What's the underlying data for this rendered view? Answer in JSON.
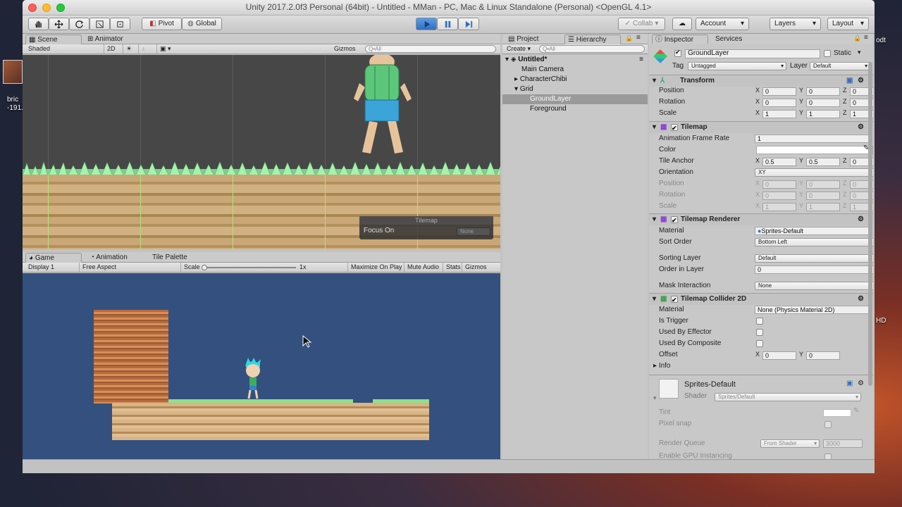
{
  "desktop": {
    "right_label": "odt",
    "left_label_1": "bric",
    "left_label_2": "-191...",
    "side_label": "HD"
  },
  "window": {
    "title": "Unity 2017.2.0f3 Personal (64bit) - Untitled - MMan - PC, Mac & Linux Standalone (Personal) <OpenGL 4.1>"
  },
  "toolbar": {
    "pivot": "Pivot",
    "global": "Global",
    "collab": "Collab",
    "account": "Account",
    "layers": "Layers",
    "layout": "Layout"
  },
  "scene_panel": {
    "tab_scene": "Scene",
    "tab_animator": "Animator",
    "shading": "Shaded",
    "mode_2d": "2D",
    "gizmos": "Gizmos",
    "search_placeholder": "Q•All",
    "overlay_title": "Tilemap",
    "overlay_label": "Focus On",
    "overlay_value": "None"
  },
  "game_panel": {
    "tab_game": "Game",
    "tab_animation": "Animation",
    "tab_tile_palette": "Tile Palette",
    "display": "Display 1",
    "aspect": "Free Aspect",
    "scale_label": "Scale",
    "scale_value": "1x",
    "maximize": "Maximize On Play",
    "mute": "Mute Audio",
    "stats": "Stats",
    "gizmos": "Gizmos"
  },
  "hierarchy": {
    "tab_project": "Project",
    "tab_hierarchy": "Hierarchy",
    "create": "Create",
    "search_placeholder": "Q•All",
    "scene": "Untitled*",
    "items": [
      "Main Camera",
      "CharacterChibi",
      "Grid",
      "GroundLayer",
      "Foreground"
    ]
  },
  "inspector": {
    "tab_inspector": "Inspector",
    "tab_services": "Services",
    "object_name": "GroundLayer",
    "static": "Static",
    "tag_label": "Tag",
    "tag_value": "Untagged",
    "layer_label": "Layer",
    "layer_value": "Default",
    "transform": {
      "title": "Transform",
      "position": "Position",
      "rotation": "Rotation",
      "scale": "Scale",
      "pos": [
        "0",
        "0",
        "0"
      ],
      "rot": [
        "0",
        "0",
        "0"
      ],
      "scl": [
        "1",
        "1",
        "1"
      ]
    },
    "tilemap": {
      "title": "Tilemap",
      "anim_rate_label": "Animation Frame Rate",
      "anim_rate": "1",
      "color_label": "Color",
      "anchor_label": "Tile Anchor",
      "anchor": [
        "0.5",
        "0.5",
        "0"
      ],
      "orientation_label": "Orientation",
      "orientation": "XY",
      "position": "Position",
      "rotation": "Rotation",
      "scale": "Scale",
      "pos": [
        "0",
        "0",
        "0"
      ],
      "rot": [
        "0",
        "0",
        "0"
      ],
      "scl": [
        "1",
        "1",
        "1"
      ]
    },
    "renderer": {
      "title": "Tilemap Renderer",
      "material_label": "Material",
      "material": "Sprites-Default",
      "sort_label": "Sort Order",
      "sort": "Bottom Left",
      "sorting_layer_label": "Sorting Layer",
      "sorting_layer": "Default",
      "order_label": "Order in Layer",
      "order": "0",
      "mask_label": "Mask Interaction",
      "mask": "None"
    },
    "collider": {
      "title": "Tilemap Collider 2D",
      "material_label": "Material",
      "material": "None (Physics Material 2D)",
      "trigger": "Is Trigger",
      "effector": "Used By Effector",
      "composite": "Used By Composite",
      "offset_label": "Offset",
      "offset": [
        "0",
        "0"
      ],
      "info": "Info"
    },
    "material_section": {
      "name": "Sprites-Default",
      "shader_label": "Shader",
      "shader": "Sprites/Default",
      "tint": "Tint",
      "pixel_snap": "Pixel snap",
      "render_queue": "Render Queue",
      "render_queue_mode": "From Shader",
      "render_queue_value": "3000",
      "gpu": "Enable GPU Instancing"
    },
    "axes": {
      "x": "X",
      "y": "Y",
      "z": "Z"
    }
  }
}
